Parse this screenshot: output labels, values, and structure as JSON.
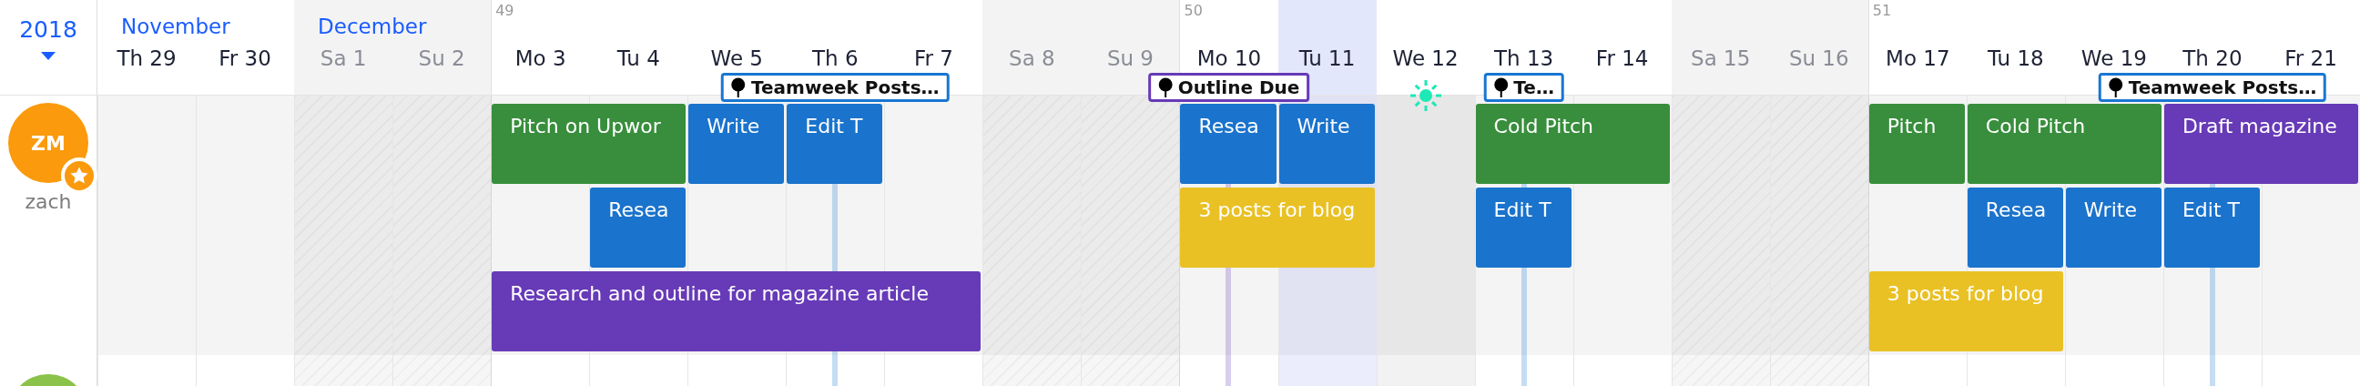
{
  "year": "2018",
  "days": [
    {
      "label": "Th 29",
      "month": "November",
      "weekend": false,
      "today": false,
      "holiday": false
    },
    {
      "label": "Fr 30",
      "weekend": false,
      "today": false,
      "holiday": false
    },
    {
      "label": "Sa 1",
      "month": "December",
      "weekend": true,
      "today": false,
      "holiday": false
    },
    {
      "label": "Su 2",
      "weekend": true,
      "today": false,
      "holiday": false
    },
    {
      "label": "Mo 3",
      "week": "49",
      "weekend": false,
      "today": false,
      "holiday": false
    },
    {
      "label": "Tu 4",
      "weekend": false,
      "today": false,
      "holiday": false
    },
    {
      "label": "We 5",
      "weekend": false,
      "today": false,
      "holiday": false
    },
    {
      "label": "Th 6",
      "weekend": false,
      "today": false,
      "holiday": false,
      "milestone": {
        "label": "Teamweek Posts…",
        "color": "#1976d2"
      }
    },
    {
      "label": "Fr 7",
      "weekend": false,
      "today": false,
      "holiday": false
    },
    {
      "label": "Sa 8",
      "weekend": true,
      "today": false,
      "holiday": false
    },
    {
      "label": "Su 9",
      "weekend": true,
      "today": false,
      "holiday": false
    },
    {
      "label": "Mo 10",
      "week": "50",
      "weekend": false,
      "today": false,
      "holiday": false,
      "milestone": {
        "label": "Outline Due",
        "color": "#673ab7"
      }
    },
    {
      "label": "Tu 11",
      "weekend": false,
      "today": true,
      "holiday": false
    },
    {
      "label": "We 12",
      "weekend": false,
      "today": false,
      "holiday": true
    },
    {
      "label": "Th 13",
      "weekend": false,
      "today": false,
      "holiday": false,
      "milestone": {
        "label": "Te…",
        "color": "#1976d2"
      }
    },
    {
      "label": "Fr 14",
      "weekend": false,
      "today": false,
      "holiday": false
    },
    {
      "label": "Sa 15",
      "weekend": true,
      "today": false,
      "holiday": false
    },
    {
      "label": "Su 16",
      "weekend": true,
      "today": false,
      "holiday": false
    },
    {
      "label": "Mo 17",
      "week": "51",
      "weekend": false,
      "today": false,
      "holiday": false
    },
    {
      "label": "Tu 18",
      "weekend": false,
      "today": false,
      "holiday": false
    },
    {
      "label": "We 19",
      "weekend": false,
      "today": false,
      "holiday": false
    },
    {
      "label": "Th 20",
      "weekend": false,
      "today": false,
      "holiday": false,
      "milestone": {
        "label": "Teamweek Posts…",
        "color": "#1976d2"
      }
    },
    {
      "label": "Fr 21",
      "weekend": false,
      "today": false,
      "holiday": false
    }
  ],
  "users": [
    {
      "initials": "ZM",
      "name": "zach",
      "color": "#fb9a0c",
      "owner": true
    },
    {
      "color": "#8bc34a"
    }
  ],
  "lanes": [
    {
      "cells": [
        {
          "kind": "empty"
        },
        {
          "kind": "empty"
        },
        {
          "kind": "empty"
        },
        {
          "kind": "empty"
        },
        {
          "kind": "task",
          "title": "Pitch on Upwor",
          "color": "#388e3c"
        },
        {
          "kind": "continued"
        },
        {
          "kind": "task",
          "title": "Write",
          "color": "#1a73cc"
        },
        {
          "kind": "task",
          "title": "Edit T",
          "color": "#1a73cc"
        },
        {
          "kind": "empty"
        },
        {
          "kind": "empty"
        },
        {
          "kind": "empty"
        },
        {
          "kind": "task",
          "title": "Resea",
          "color": "#1a73cc"
        },
        {
          "kind": "task",
          "title": "Write",
          "color": "#1a73cc"
        },
        {
          "kind": "empty"
        },
        {
          "kind": "task",
          "title": "Cold Pitch",
          "color": "#388e3c"
        },
        {
          "kind": "continued"
        },
        {
          "kind": "empty"
        },
        {
          "kind": "empty"
        },
        {
          "kind": "task",
          "title": "Pitch",
          "color": "#388e3c"
        },
        {
          "kind": "task",
          "title": "Cold Pitch",
          "color": "#388e3c"
        },
        {
          "kind": "continued"
        },
        {
          "kind": "task",
          "title": "Draft magazine",
          "color": "#673ab7"
        },
        {
          "kind": "continued"
        }
      ]
    },
    {
      "cells": [
        {
          "kind": "empty"
        },
        {
          "kind": "empty"
        },
        {
          "kind": "empty"
        },
        {
          "kind": "empty"
        },
        {
          "kind": "empty"
        },
        {
          "kind": "task",
          "title": "Resea",
          "color": "#1a73cc"
        },
        {
          "kind": "empty"
        },
        {
          "kind": "empty"
        },
        {
          "kind": "empty"
        },
        {
          "kind": "empty"
        },
        {
          "kind": "empty"
        },
        {
          "kind": "task",
          "title": "3 posts for blog",
          "color": "#e9c125"
        },
        {
          "kind": "continued"
        },
        {
          "kind": "empty"
        },
        {
          "kind": "task",
          "title": "Edit T",
          "color": "#1a73cc"
        },
        {
          "kind": "empty"
        },
        {
          "kind": "empty"
        },
        {
          "kind": "empty"
        },
        {
          "kind": "empty"
        },
        {
          "kind": "task",
          "title": "Resea",
          "color": "#1a73cc"
        },
        {
          "kind": "task",
          "title": "Write",
          "color": "#1a73cc"
        },
        {
          "kind": "task",
          "title": "Edit T",
          "color": "#1a73cc"
        },
        {
          "kind": "empty"
        }
      ]
    },
    {
      "cells": [
        {
          "kind": "empty"
        },
        {
          "kind": "empty"
        },
        {
          "kind": "empty"
        },
        {
          "kind": "empty"
        },
        {
          "kind": "task",
          "title": "Research and outline for magazine article",
          "color": "#673ab7"
        },
        {
          "kind": "continued"
        },
        {
          "kind": "continued"
        },
        {
          "kind": "continued"
        },
        {
          "kind": "continued"
        },
        {
          "kind": "empty"
        },
        {
          "kind": "empty"
        },
        {
          "kind": "empty"
        },
        {
          "kind": "empty"
        },
        {
          "kind": "empty"
        },
        {
          "kind": "empty"
        },
        {
          "kind": "empty"
        },
        {
          "kind": "empty"
        },
        {
          "kind": "empty"
        },
        {
          "kind": "task",
          "title": "3 posts for blog",
          "color": "#e9c125"
        },
        {
          "kind": "continued"
        },
        {
          "kind": "empty"
        },
        {
          "kind": "empty"
        },
        {
          "kind": "empty"
        }
      ]
    }
  ]
}
